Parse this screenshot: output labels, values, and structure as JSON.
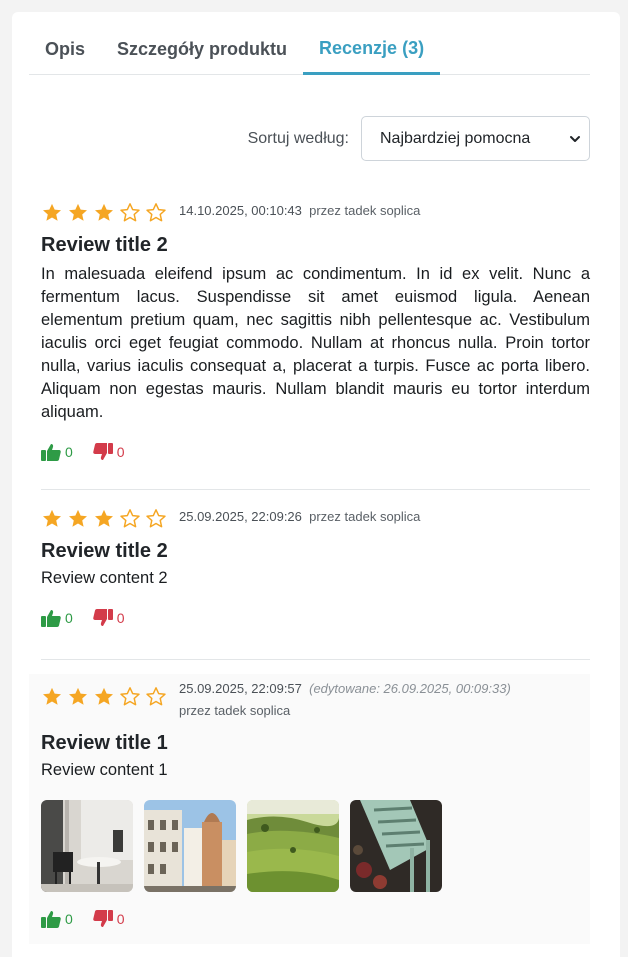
{
  "tabs": [
    {
      "label": "Opis"
    },
    {
      "label": "Szczegóły produktu"
    },
    {
      "label": "Recenzje (3)"
    }
  ],
  "sort": {
    "label": "Sortuj według:",
    "selected": "Najbardziej pomocna"
  },
  "reviews": [
    {
      "rating": 3,
      "max_rating": 5,
      "date": "14.10.2025, 00:10:43",
      "author": "przez tadek soplica",
      "title": "Review title 2",
      "content": "In malesuada eleifend ipsum ac condimentum. In id ex velit. Nunc a fermentum lacus. Suspendisse sit amet euismod ligula. Aenean elementum pretium quam, nec sagittis nibh pellentesque ac. Vestibulum iaculis orci eget feugiat commodo. Nullam at rhoncus nulla. Proin tortor nulla, varius iaculis consequat a, placerat a turpis. Fusce ac porta libero. Aliquam non egestas mauris. Nullam blandit mauris eu tortor interdum aliquam.",
      "upvotes": "0",
      "downvotes": "0"
    },
    {
      "rating": 3,
      "max_rating": 5,
      "date": "25.09.2025, 22:09:26",
      "author": "przez tadek soplica",
      "title": "Review title 2",
      "content": "Review content 2",
      "upvotes": "0",
      "downvotes": "0"
    },
    {
      "rating": 3,
      "max_rating": 5,
      "date": "25.09.2025, 22:09:57",
      "edited": "(edytowane: 26.09.2025, 00:09:33)",
      "author": "przez tadek soplica",
      "title": "Review title 1",
      "content": "Review content 1",
      "upvotes": "0",
      "downvotes": "0"
    }
  ],
  "colors": {
    "accent": "#3a9fc1",
    "star": "#f5a623",
    "upvote": "#2e9b46",
    "downvote": "#d33b4a"
  },
  "icons": {
    "star": "star-icon",
    "thumbs_up": "thumbs-up-icon",
    "thumbs_down": "thumbs-down-icon",
    "dropdown": "chevron-down-icon"
  }
}
